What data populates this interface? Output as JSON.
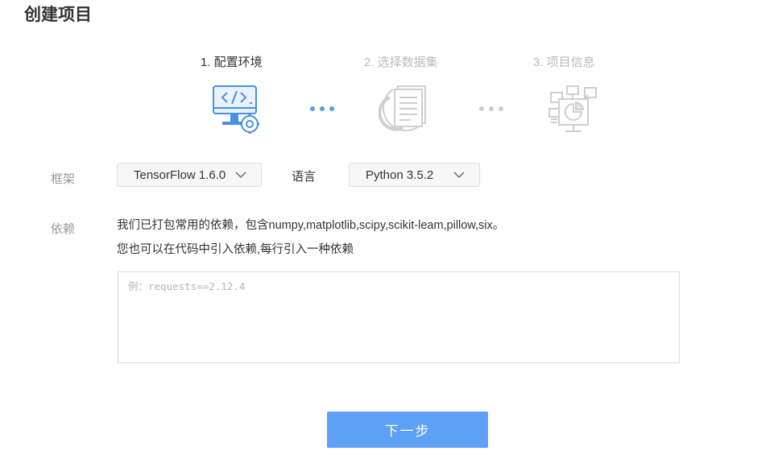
{
  "page": {
    "title": "创建项目"
  },
  "steps": [
    {
      "label": "1. 配置环境",
      "active": true
    },
    {
      "label": "2. 选择数据集",
      "active": false
    },
    {
      "label": "3. 项目信息",
      "active": false
    }
  ],
  "colors": {
    "accent": "#5ea0f5",
    "inactive": "#cfcfcf",
    "dots_active": "#5b9be8",
    "dots_inactive": "#cccccc"
  },
  "icons": [
    "code-monitor-gear-icon",
    "dataset-documents-icon",
    "project-info-chart-icon",
    "chevron-down-icon"
  ],
  "form": {
    "framework": {
      "label": "框架",
      "value": "TensorFlow 1.6.0"
    },
    "language": {
      "label": "语言",
      "value": "Python 3.5.2"
    },
    "dependencies": {
      "label": "依赖",
      "line1": "我们已打包常用的依赖，包含numpy,matplotlib,scipy,scikit-leam,pillow,six。",
      "line2": "您也可以在代码中引入依赖,每行引入一种依赖",
      "placeholder": "例：requests==2.12.4",
      "value": ""
    }
  },
  "actions": {
    "next_label": "下一步"
  }
}
